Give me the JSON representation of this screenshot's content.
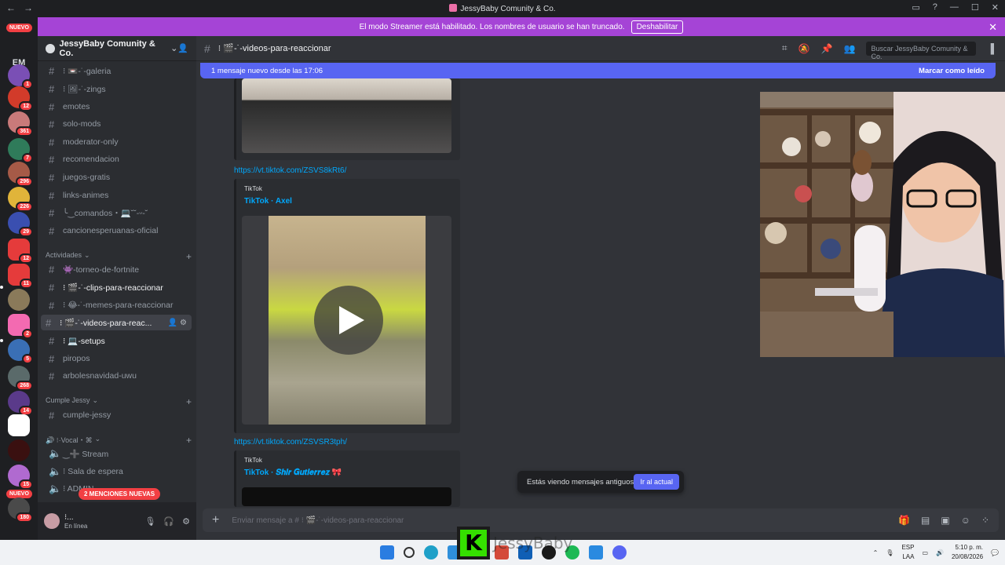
{
  "window": {
    "title": "JessyBaby Comunity & Co."
  },
  "banner": {
    "text": "El modo Streamer está habilitado. Los nombres de usuario se han truncado.",
    "button": "Deshabilitar"
  },
  "servers": {
    "new_top": "NUEVO",
    "initials": "EM",
    "badges": [
      "1",
      "12",
      "361",
      "7",
      "296",
      "226",
      "29",
      "12",
      "11",
      "2",
      "5",
      "268",
      "14",
      "15",
      "180"
    ],
    "new_bottom": "NUEVO"
  },
  "guild": {
    "name": "JessyBaby Comunity & Co."
  },
  "channels": [
    {
      "label": "⁝ 📼-˙-galeria"
    },
    {
      "label": "⁝ 🖼-˙-zings"
    },
    {
      "label": "emotes"
    },
    {
      "label": "solo-mods"
    },
    {
      "label": "moderator-only"
    },
    {
      "label": "recomendacion"
    },
    {
      "label": "juegos-gratis"
    },
    {
      "label": "links-animes"
    },
    {
      "label": "╰‿comandos・💻˘˘-ᵕ-˘"
    },
    {
      "label": "cancionesperuanas-oficial"
    }
  ],
  "category_actividades": "Actividades",
  "channels_actividades": [
    {
      "label": "👾-torneo-de-fortnite"
    },
    {
      "label": "⁝ 🎬-˙-clips-para-reaccionar"
    },
    {
      "label": "⁝ 😂-˙-memes-para-reaccionar"
    },
    {
      "label": "⁝ 🎬-˙-videos-para-reac..."
    },
    {
      "label": "⁝ 💻-setups"
    },
    {
      "label": "piropos"
    },
    {
      "label": "arbolesnavidad-uwu"
    }
  ],
  "category_cumple": "Cumple Jessy",
  "channels_cumple": [
    {
      "label": "cumple-jessy"
    }
  ],
  "category_vocal": "🔊 ⁝·Vocal・⌘",
  "voice_channels": [
    {
      "label": "‿➕ Stream"
    },
    {
      "label": "⁝ Sala de espera"
    },
    {
      "label": "⁝ ADMIN"
    }
  ],
  "mentions": "2 MENCIONES NUEVAS",
  "user": {
    "name": "⁝...",
    "status": "En línea"
  },
  "header": {
    "channel": "⁝ 🎬-˙-videos-para-reaccionar",
    "search_placeholder": "Buscar JessyBaby Comunity & Co."
  },
  "new_messages": {
    "left": "1 mensaje nuevo desde las 17:06",
    "right": "Marcar como leído"
  },
  "messages": {
    "link1": "https://vt.tiktok.com/ZSVS8kRt6/",
    "embed1_provider": "TikTok",
    "embed1_title": "TikTok · Axel",
    "link2": "https://vt.tiktok.com/ZSVSR3tph/",
    "embed2_provider": "TikTok",
    "embed2_title": "TikTok · 𝑺𝒉𝒊𝒓 𝑮𝒖𝒕𝒊𝒆𝒓𝒓𝒆𝒛 🎀"
  },
  "old_messages": {
    "text": "Estás viendo mensajes antiguos",
    "button": "Ir al actual"
  },
  "composer": {
    "placeholder": "Enviar mensaje a # ⁝ 🎬-˙-videos-para-reaccionar"
  },
  "taskbar": {
    "lang1": "ESP",
    "lang2": "LAA",
    "time": "5:10 p. m.",
    "date": "20/08/2026",
    "overlay_text": "JessyBaby",
    "overlay_logo": "K"
  }
}
